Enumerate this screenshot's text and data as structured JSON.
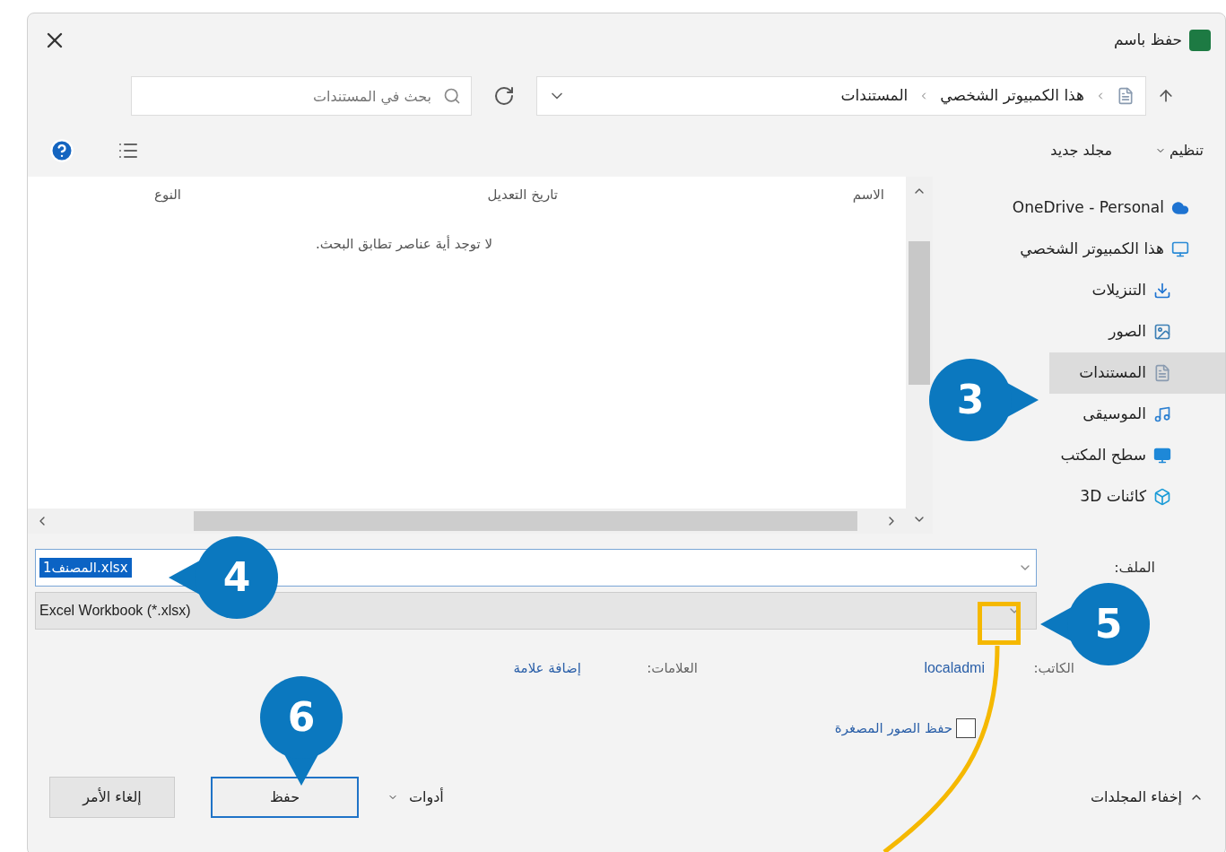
{
  "window": {
    "title": "حفظ باسم"
  },
  "address": {
    "path": [
      "هذا الكمبيوتر الشخصي",
      "المستندات"
    ],
    "search_placeholder": "بحث في المستندات"
  },
  "toolbar": {
    "organize": "تنظيم",
    "new_folder": "مجلد جديد"
  },
  "sidebar": {
    "items": [
      {
        "label": "OneDrive - Personal",
        "selected": false
      },
      {
        "label": "هذا الكمبيوتر الشخصي",
        "selected": false,
        "children": [
          {
            "label": "التنزيلات",
            "selected": false
          },
          {
            "label": "الصور",
            "selected": false
          },
          {
            "label": "المستندات",
            "selected": true
          },
          {
            "label": "الموسيقى",
            "selected": false
          },
          {
            "label": "سطح المكتب",
            "selected": false
          },
          {
            "label": "كائنات 3D",
            "selected": false
          }
        ]
      }
    ]
  },
  "table": {
    "columns": [
      "الاسم",
      "تاريخ التعديل",
      "النوع"
    ],
    "empty_message": "لا توجد أية عناصر تطابق البحث."
  },
  "form": {
    "file_name_label": "الملف:",
    "file_name": "المصنف1.xlsx",
    "file_type": "Excel Workbook (*.xlsx)",
    "author_label": "الكاتب:",
    "author": "localadmi",
    "tags_label": "العلامات:",
    "tags_link": "إضافة علامة",
    "thumbnail": {
      "label": "حفظ الصور المصغرة",
      "checked": false
    }
  },
  "footer": {
    "hide_folders": "إخفاء المجلدات",
    "tools": "أدوات",
    "save": "حفظ",
    "cancel": "إلغاء الأمر"
  },
  "callouts": [
    {
      "label": "3"
    },
    {
      "label": "4"
    },
    {
      "label": "5"
    },
    {
      "label": "6"
    }
  ]
}
